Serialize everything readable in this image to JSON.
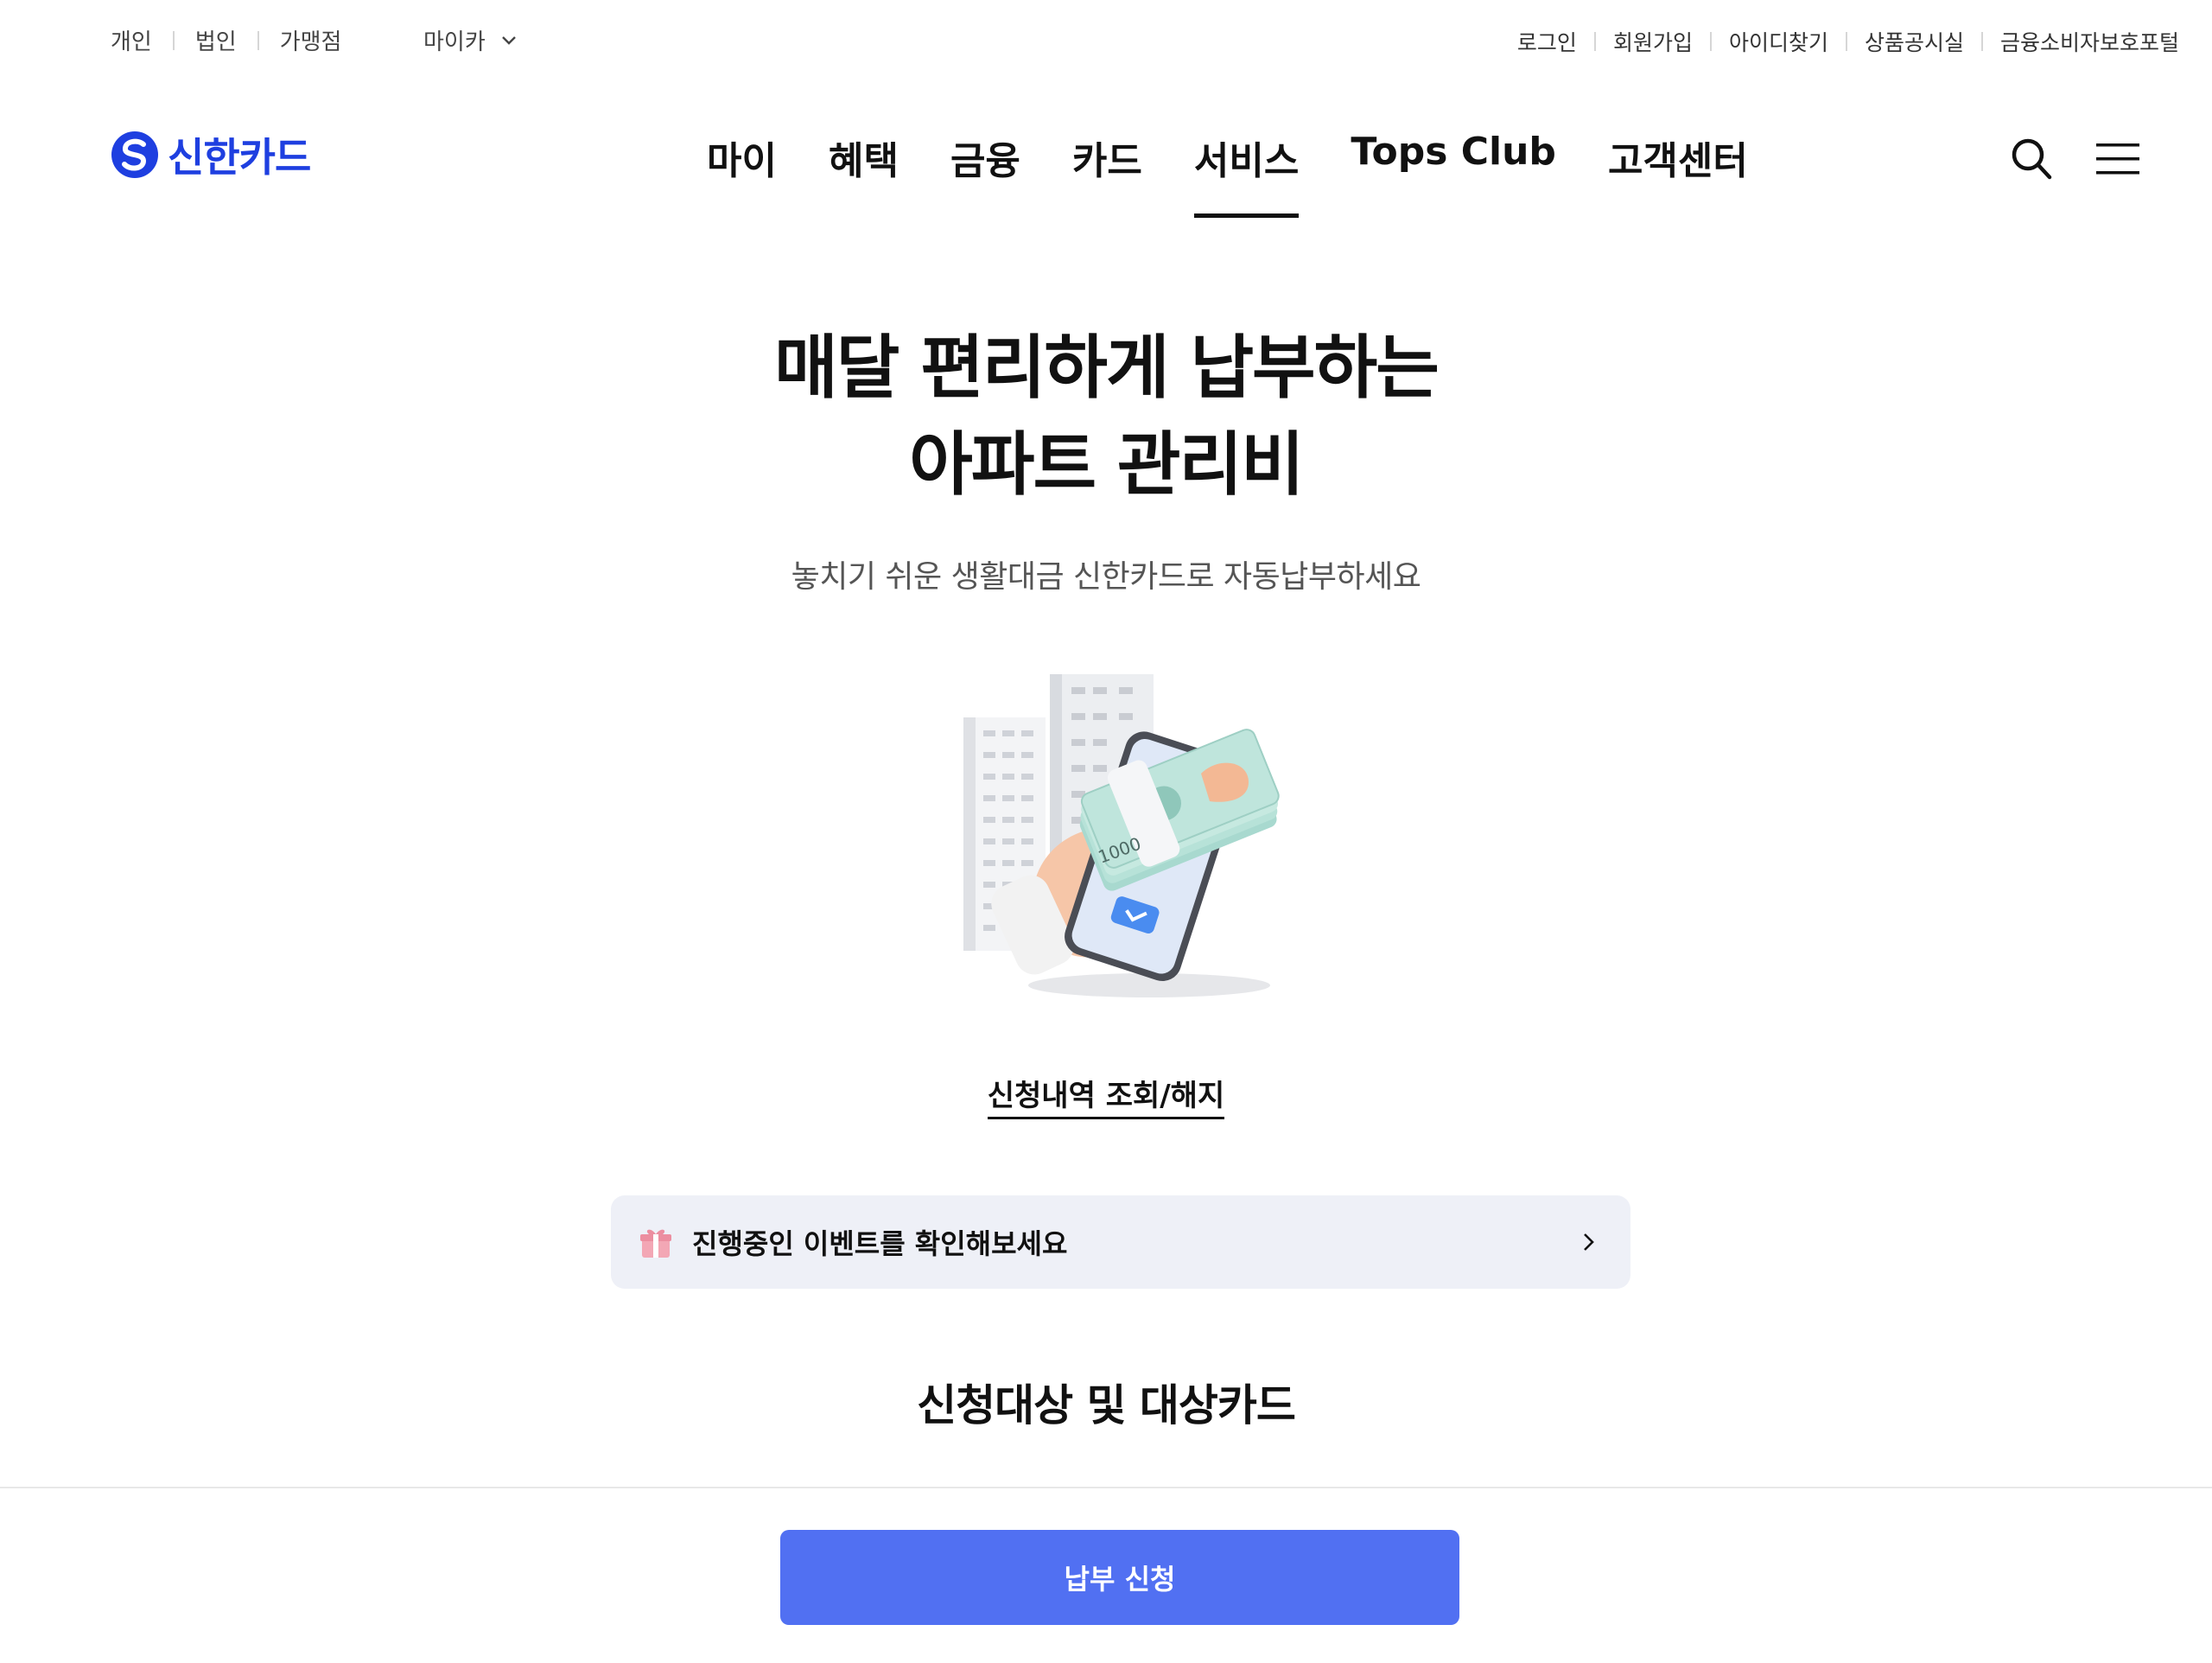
{
  "utility": {
    "segments": [
      "개인",
      "법인",
      "가맹점"
    ],
    "mycar": "마이카",
    "links": [
      "로그인",
      "회원가입",
      "아이디찾기",
      "상품공시실",
      "금융소비자보호포털"
    ]
  },
  "header": {
    "logo_text": "신한카드",
    "nav": [
      "마이",
      "혜택",
      "금융",
      "카드",
      "서비스",
      "Tops Club",
      "고객센터"
    ],
    "active_nav": "서비스"
  },
  "hero": {
    "title_line1": "매달 편리하게 납부하는",
    "title_line2": "아파트 관리비",
    "subtitle": "놓치기 쉬운 생활대금 신한카드로 자동납부하세요",
    "bill_text": "1000"
  },
  "history_link": "신청내역 조회/해지",
  "event_banner": {
    "text": "진행중인 이벤트를 확인해보세요"
  },
  "section_title": "신청대상 및 대상카드",
  "bottom": {
    "apply_label": "납부 신청"
  },
  "colors": {
    "brand": "#1e3fe0",
    "button": "#5170f2",
    "banner_bg": "#eef0f7"
  }
}
